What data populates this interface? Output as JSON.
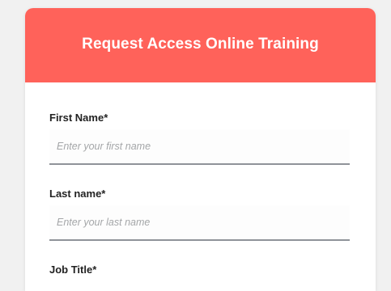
{
  "form": {
    "title": "Request Access Online Training",
    "fields": [
      {
        "label": "First Name*",
        "placeholder": "Enter your first name",
        "value": ""
      },
      {
        "label": "Last name*",
        "placeholder": "Enter your last name",
        "value": ""
      },
      {
        "label": "Job Title*"
      }
    ]
  },
  "colors": {
    "header": "#ff625a",
    "background": "#f1f1f1",
    "card": "#ffffff",
    "input_underline": "#8f9399"
  }
}
